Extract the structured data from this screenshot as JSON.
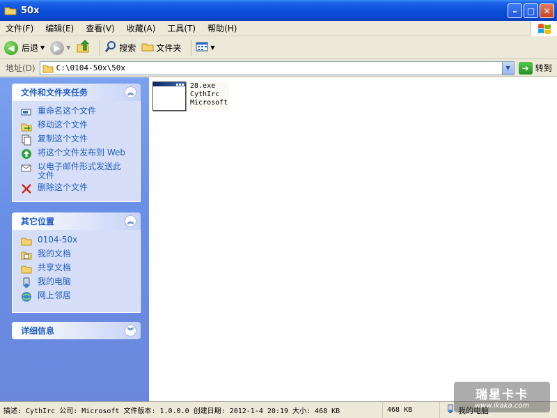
{
  "window": {
    "title": "50x"
  },
  "menu": {
    "items": [
      "文件(F)",
      "编辑(E)",
      "查看(V)",
      "收藏(A)",
      "工具(T)",
      "帮助(H)"
    ]
  },
  "toolbar": {
    "back_label": "后退",
    "search_label": "搜索",
    "folders_label": "文件夹"
  },
  "address": {
    "label": "地址(D)",
    "path": "C:\\0104-50x\\50x",
    "go_label": "转到"
  },
  "tasks_panel": {
    "title": "文件和文件夹任务",
    "items": [
      "重命名这个文件",
      "移动这个文件",
      "复制这个文件",
      "将这个文件发布到 Web",
      "以电子邮件形式发送此文件",
      "删除这个文件"
    ]
  },
  "places_panel": {
    "title": "其它位置",
    "items": [
      "0104-50x",
      "我的文档",
      "共享文档",
      "我的电脑",
      "网上邻居"
    ]
  },
  "details_panel": {
    "title": "详细信息"
  },
  "file": {
    "name": "28.exe",
    "description": "CythIrc",
    "company": "Microsoft"
  },
  "status": {
    "description": "描述: CythIrc 公司: Microsoft 文件版本: 1.0.0.0 创建日期: 2012-1-4 20:19 大小: 468 KB",
    "size": "468 KB",
    "location": "我的电脑"
  },
  "watermark": {
    "main": "瑞星卡卡",
    "sub": "www.ikaka.com"
  },
  "colors": {
    "title_blue": "#0b4fd9",
    "left_pane": "#6a8fe6",
    "task_link": "#215dc6"
  }
}
